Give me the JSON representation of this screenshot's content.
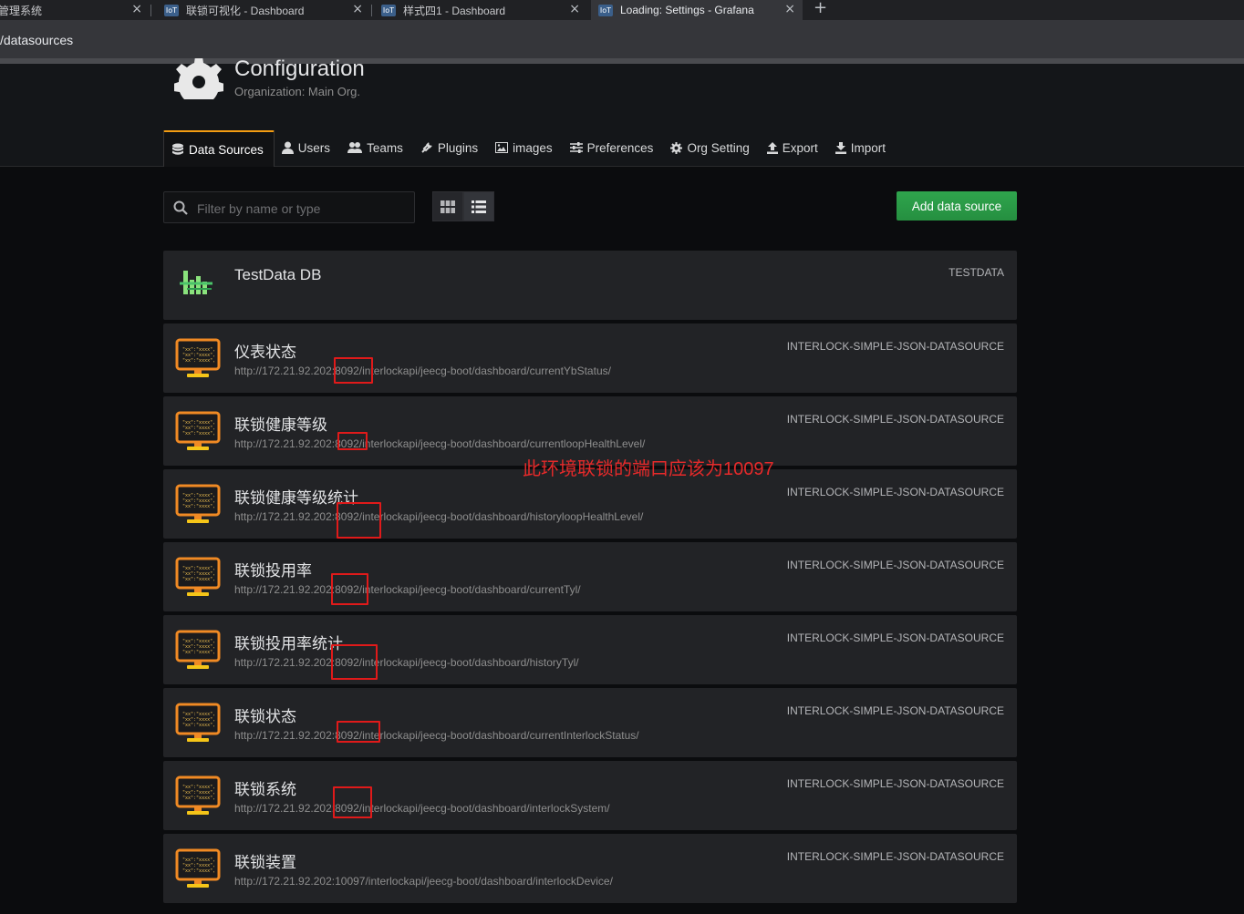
{
  "browser": {
    "tabs": [
      {
        "title": "管理系统"
      },
      {
        "title": "联锁可视化 - Dashboard"
      },
      {
        "title": "样式四1 - Dashboard"
      },
      {
        "title": "Loading: Settings - Grafana"
      }
    ],
    "new_tab": "+",
    "url": "/datasources"
  },
  "header": {
    "title": "Configuration",
    "subtitle": "Organization: Main Org."
  },
  "nav": [
    {
      "label": "Data Sources",
      "icon": "database-icon"
    },
    {
      "label": "Users",
      "icon": "user-icon"
    },
    {
      "label": "Teams",
      "icon": "users-icon"
    },
    {
      "label": "Plugins",
      "icon": "plug-icon"
    },
    {
      "label": "images",
      "icon": "image-icon"
    },
    {
      "label": "Preferences",
      "icon": "sliders-icon"
    },
    {
      "label": "Org Setting",
      "icon": "gear-icon"
    },
    {
      "label": "Export",
      "icon": "upload-icon"
    },
    {
      "label": "Import",
      "icon": "download-icon"
    }
  ],
  "toolbar": {
    "filter_placeholder": "Filter by name or type",
    "add_label": "Add data source"
  },
  "datasources": [
    {
      "name": "TestData DB",
      "url": "",
      "type": "TESTDATA"
    },
    {
      "name": "仪表状态",
      "url": "http://172.21.92.202:8092/interlockapi/jeecg-boot/dashboard/currentYbStatus/",
      "type": "INTERLOCK-SIMPLE-JSON-DATASOURCE"
    },
    {
      "name": "联锁健康等级",
      "url": "http://172.21.92.202:8092/interlockapi/jeecg-boot/dashboard/currentloopHealthLevel/",
      "type": "INTERLOCK-SIMPLE-JSON-DATASOURCE"
    },
    {
      "name": "联锁健康等级统计",
      "url": "http://172.21.92.202:8092/interlockapi/jeecg-boot/dashboard/historyloopHealthLevel/",
      "type": "INTERLOCK-SIMPLE-JSON-DATASOURCE"
    },
    {
      "name": "联锁投用率",
      "url": "http://172.21.92.202:8092/interlockapi/jeecg-boot/dashboard/currentTyl/",
      "type": "INTERLOCK-SIMPLE-JSON-DATASOURCE"
    },
    {
      "name": "联锁投用率统计",
      "url": "http://172.21.92.202:8092/interlockapi/jeecg-boot/dashboard/historyTyl/",
      "type": "INTERLOCK-SIMPLE-JSON-DATASOURCE"
    },
    {
      "name": "联锁状态",
      "url": "http://172.21.92.202:8092/interlockapi/jeecg-boot/dashboard/currentInterlockStatus/",
      "type": "INTERLOCK-SIMPLE-JSON-DATASOURCE"
    },
    {
      "name": "联锁系统",
      "url": "http://172.21.92.202:8092/interlockapi/jeecg-boot/dashboard/interlockSystem/",
      "type": "INTERLOCK-SIMPLE-JSON-DATASOURCE"
    },
    {
      "name": "联锁装置",
      "url": "http://172.21.92.202:10097/interlockapi/jeecg-boot/dashboard/interlockDevice/",
      "type": "INTERLOCK-SIMPLE-JSON-DATASOURCE"
    }
  ],
  "annotation": "此环境联锁的端口应该为10097",
  "colors": {
    "accent": "#f39c12",
    "primary_button": "#299c46",
    "annotation": "#e52a2a"
  }
}
